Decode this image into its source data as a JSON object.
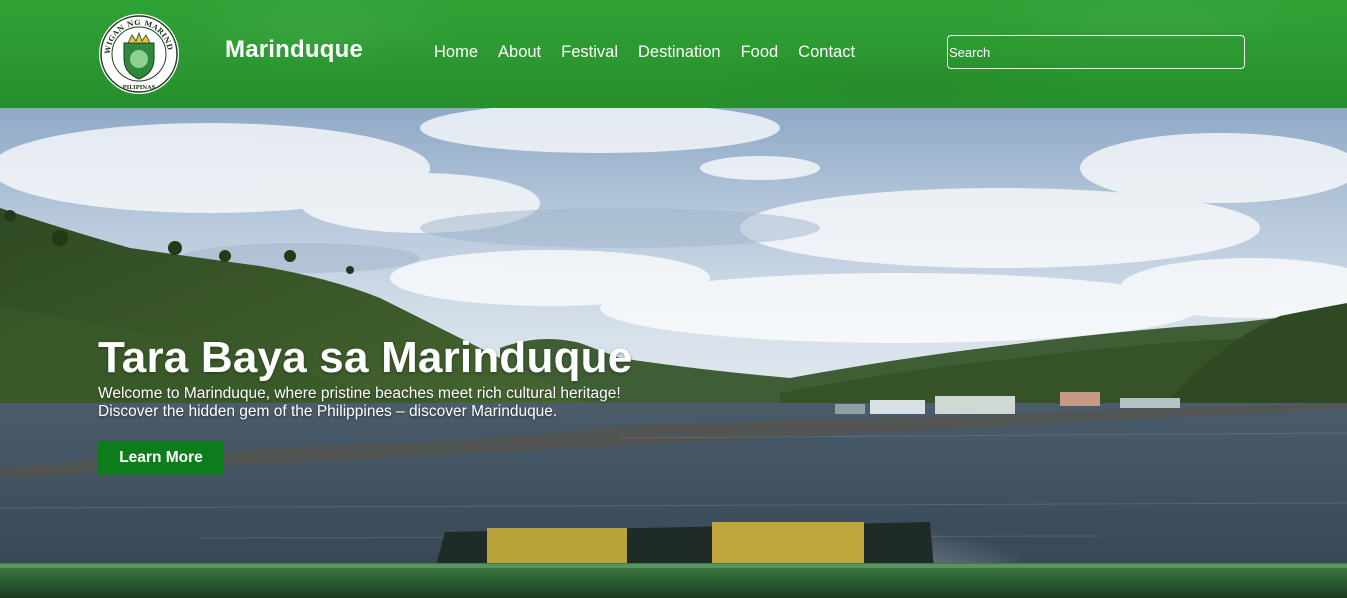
{
  "header": {
    "brand": "Marinduque",
    "logo": {
      "ring_text": "LALAWIGAN NG MARINDUQUE",
      "bottom_text": "PILIPINAS"
    },
    "nav": [
      "Home",
      "About",
      "Festival",
      "Destination",
      "Food",
      "Contact"
    ],
    "search": {
      "placeholder": "Search",
      "value": ""
    }
  },
  "hero": {
    "title": "Tara Baya sa Marinduque",
    "line1": "Welcome to Marinduque, where pristine beaches meet rich cultural heritage!",
    "line2": "Discover the hidden gem of the Philippines – discover Marinduque.",
    "button_label": "Learn More"
  },
  "colors": {
    "header_green": "#2c9a31",
    "button_green": "#0d7d1b",
    "text": "#ffffff"
  }
}
